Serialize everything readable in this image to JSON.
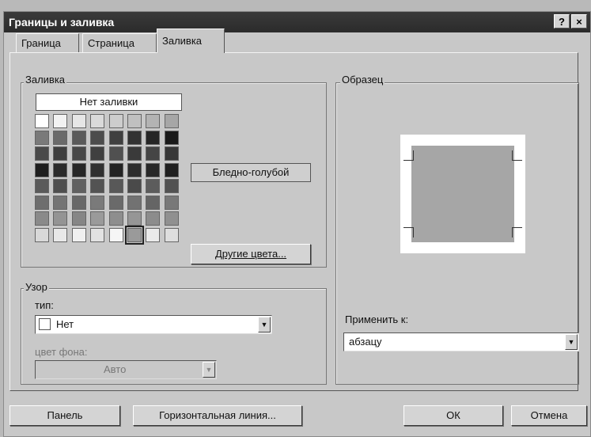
{
  "window": {
    "title": "Границы и заливка",
    "help_label": "?",
    "close_label": "×"
  },
  "tabs": [
    {
      "label": "Граница",
      "active": false
    },
    {
      "label": "Страница",
      "active": false
    },
    {
      "label": "Заливка",
      "active": true
    }
  ],
  "fill": {
    "group_label": "Заливка",
    "no_fill_label": "Нет заливки",
    "swatch_colors": [
      [
        "#ffffff",
        "#f2f2f2",
        "#e6e6e6",
        "#dadada",
        "#cdcdcd",
        "#c0c0c0",
        "#b3b3b3",
        "#a6a6a6"
      ],
      [
        "#7a7a7a",
        "#6a6a6a",
        "#5a5a5a",
        "#4c4c4c",
        "#404040",
        "#333333",
        "#262626",
        "#1a1a1a"
      ],
      [
        "#4a4a4a",
        "#3e3e3e",
        "#484848",
        "#404040",
        "#505050",
        "#3a3a3a",
        "#454545",
        "#383838"
      ],
      [
        "#1e1e1e",
        "#2a2a2a",
        "#262626",
        "#303030",
        "#232323",
        "#2d2d2d",
        "#282828",
        "#202020"
      ],
      [
        "#5a5a5a",
        "#4e4e4e",
        "#606060",
        "#535353",
        "#585858",
        "#4a4a4a",
        "#5c5c5c",
        "#525252"
      ],
      [
        "#6e6e6e",
        "#747474",
        "#686868",
        "#7a7a7a",
        "#6a6a6a",
        "#727272",
        "#656565",
        "#787878"
      ],
      [
        "#8a8a8a",
        "#949494",
        "#868686",
        "#9a9a9a",
        "#8e8e8e",
        "#969696",
        "#8c8c8c",
        "#909090"
      ],
      [
        "#d8d8d8",
        "#e8e8e8",
        "#f0f0f0",
        "#e2e2e2",
        "#f6f6f6",
        "#9a9a9a",
        "#eaeaea",
        "#dedede"
      ]
    ],
    "selected_color_name": "Бледно-голубой",
    "more_colors_label": "Другие цвета..."
  },
  "pattern": {
    "group_label": "Узор",
    "type_label": "тип:",
    "type_value": "Нет",
    "bg_color_label": "цвет фона:",
    "bg_color_value": "Авто"
  },
  "preview": {
    "group_label": "Образец",
    "apply_to_label": "Применить к:",
    "apply_to_value": "абзацу"
  },
  "buttons": {
    "panel_label": "Панель",
    "horizontal_line_label": "Горизонтальная линия...",
    "ok_label": "ОК",
    "cancel_label": "Отмена"
  }
}
